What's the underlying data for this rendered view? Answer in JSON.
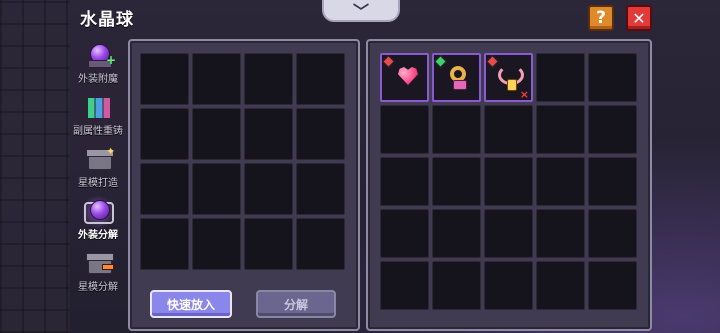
{
  "header": {
    "title": "水晶球",
    "collapse_glyph": "﹀",
    "help_label": "?",
    "close_label": "✕"
  },
  "sidebar": {
    "items": [
      {
        "label": "外装附魔",
        "icon": "crystal-ball-plus-icon",
        "active": false
      },
      {
        "label": "副属性重铸",
        "icon": "gems-icon",
        "active": false
      },
      {
        "label": "星模打造",
        "icon": "anvil-icon",
        "active": false
      },
      {
        "label": "外装分解",
        "icon": "crystal-ball-icon",
        "active": true
      },
      {
        "label": "星模分解",
        "icon": "anvil-hammer-icon",
        "active": false
      }
    ]
  },
  "left_panel": {
    "rows": 4,
    "cols": 4,
    "quick_add_label": "快速放入",
    "decompose_label": "分解"
  },
  "right_panel": {
    "rows": 5,
    "cols": 5,
    "items": [
      {
        "icon": "heart-charm-icon",
        "gem_color": "#e64b4b",
        "marked": false
      },
      {
        "icon": "gold-ring-icon",
        "gem_color": "#3fd06a",
        "marked": false
      },
      {
        "icon": "pendant-necklace-icon",
        "gem_color": "#e64b4b",
        "marked": true
      }
    ]
  },
  "colors": {
    "frame": "#8e8aa3",
    "slot": "#15131c",
    "selected_border": "#8a5ad0",
    "quick_add_button": "#8a86ea",
    "close_button": "#e23a3a",
    "help_button": "#e08a2a"
  }
}
